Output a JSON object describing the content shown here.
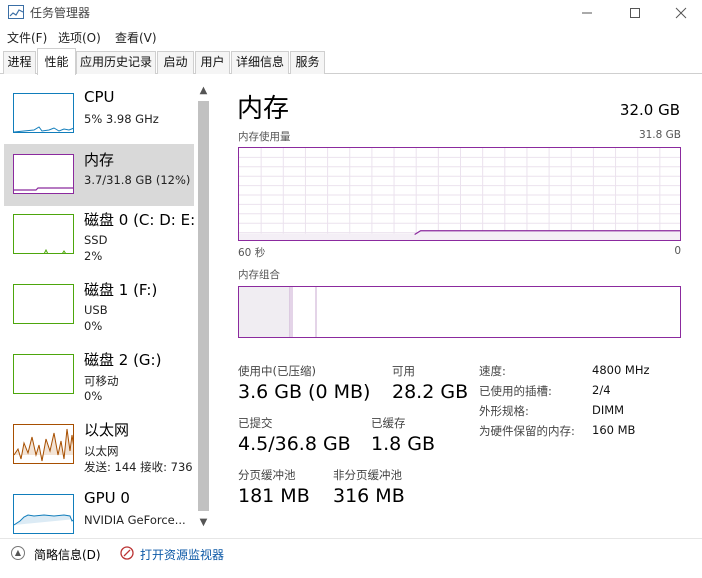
{
  "window": {
    "title": "任务管理器",
    "icon": "task-manager-icon"
  },
  "menu": [
    "文件(F)",
    "选项(O)",
    "查看(V)"
  ],
  "tabs": [
    "进程",
    "性能",
    "应用历史记录",
    "启动",
    "用户",
    "详细信息",
    "服务"
  ],
  "active_tab": "性能",
  "sidebar": {
    "items": [
      {
        "name": "CPU",
        "lines": [
          "5%  3.98 GHz"
        ],
        "color": "#117dbb"
      },
      {
        "name": "内存",
        "lines": [
          "3.7/31.8 GB (12%)"
        ],
        "color": "#8b2a9e",
        "selected": true
      },
      {
        "name": "磁盘 0 (C: D: E:",
        "lines": [
          "SSD",
          "2%"
        ],
        "color": "#4da60c"
      },
      {
        "name": "磁盘 1 (F:)",
        "lines": [
          "USB",
          "0%"
        ],
        "color": "#4da60c"
      },
      {
        "name": "磁盘 2 (G:)",
        "lines": [
          "可移动",
          "0%"
        ],
        "color": "#4da60c"
      },
      {
        "name": "以太网",
        "lines": [
          "以太网",
          "发送: 144  接收: 736"
        ],
        "color": "#a74f01"
      },
      {
        "name": "GPU 0",
        "lines": [
          "NVIDIA GeForce..."
        ],
        "color": "#117dbb"
      }
    ]
  },
  "main": {
    "title": "内存",
    "total": "32.0 GB",
    "usage_graph_label": "内存使用量",
    "usage_graph_max": "31.8 GB",
    "time_left": "60 秒",
    "time_right": "0",
    "composition_label": "内存组合",
    "usage_fraction": 0.12,
    "stats": {
      "in_use_label": "使用中(已压缩)",
      "in_use_value": "3.6 GB (0 MB)",
      "available_label": "可用",
      "available_value": "28.2 GB",
      "committed_label": "已提交",
      "committed_value": "4.5/36.8 GB",
      "cached_label": "已缓存",
      "cached_value": "1.8 GB",
      "paged_label": "分页缓冲池",
      "paged_value": "181 MB",
      "nonpaged_label": "非分页缓冲池",
      "nonpaged_value": "316 MB"
    },
    "details": [
      {
        "label": "速度:",
        "value": "4800 MHz"
      },
      {
        "label": "已使用的插槽:",
        "value": "2/4"
      },
      {
        "label": "外形规格:",
        "value": "DIMM"
      },
      {
        "label": "为硬件保留的内存:",
        "value": "160 MB"
      }
    ]
  },
  "bottom": {
    "summary_label": "简略信息(D)",
    "monitor_link": "打开资源监视器"
  }
}
